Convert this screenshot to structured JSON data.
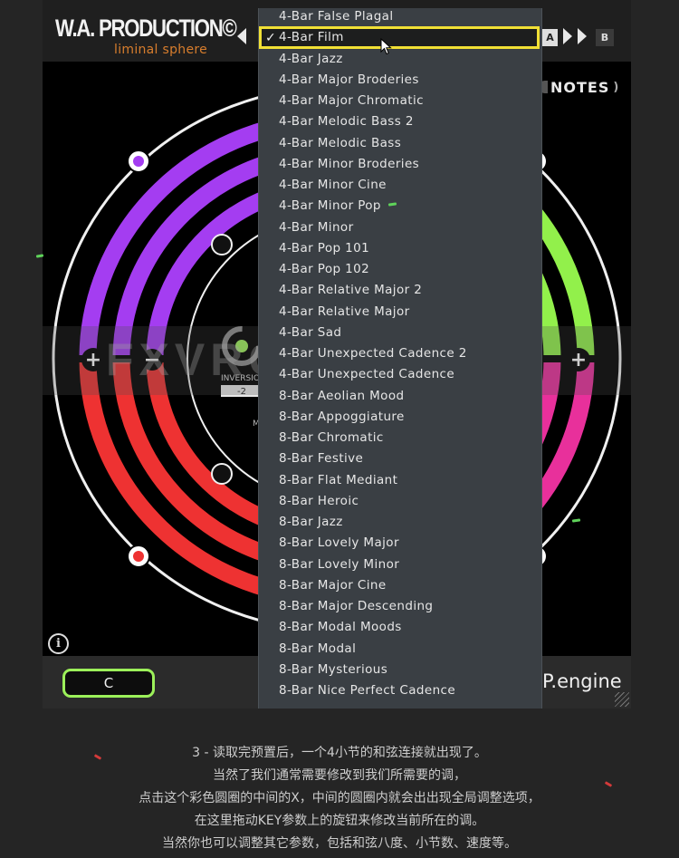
{
  "plugin": {
    "brand": "W.A. PRODUCTION",
    "copyright_mark": "©",
    "product": "liminal sphere",
    "ab_a": "A",
    "ab_b": "B",
    "notes_label": "NOTES",
    "info_icon": "i",
    "key_value": "C",
    "engine_label": "P.engine",
    "wheel": {
      "inversion_label": "INVERSIO",
      "inversion_value": "-2",
      "plus": "+",
      "minus": "−",
      "sub_label": "M",
      "colors": {
        "purple": "#a43df1",
        "red": "#ee3232",
        "green": "#92f04b",
        "pink": "#e8309b"
      }
    },
    "watermark": "FXVRGO.com"
  },
  "dropdown": {
    "selected_index": 1,
    "check_mark": "✓",
    "items": [
      "4-Bar False Plagal",
      "4-Bar Film",
      "4-Bar Jazz",
      "4-Bar Major Broderies",
      "4-Bar Major Chromatic",
      "4-Bar Melodic Bass 2",
      "4-Bar Melodic Bass",
      "4-Bar Minor Broderies",
      "4-Bar Minor Cine",
      "4-Bar Minor Pop",
      "4-Bar Minor",
      "4-Bar Pop 101",
      "4-Bar Pop 102",
      "4-Bar Relative Major 2",
      "4-Bar Relative Major",
      "4-Bar Sad",
      "4-Bar Unexpected Cadence 2",
      "4-Bar Unexpected Cadence",
      "8-Bar Aeolian Mood",
      "8-Bar Appoggiature",
      "8-Bar Chromatic",
      "8-Bar Festive",
      "8-Bar Flat Mediant",
      "8-Bar Heroic",
      "8-Bar Jazz",
      "8-Bar Lovely Major",
      "8-Bar Lovely Minor",
      "8-Bar Major Cine",
      "8-Bar Major Descending",
      "8-Bar Modal Moods",
      "8-Bar Modal",
      "8-Bar Mysterious",
      "8-Bar Nice Perfect Cadence"
    ]
  },
  "caption": {
    "lines": [
      "3 - 读取完预置后，一个4小节的和弦连接就出现了。",
      "当然了我们通常需要修改到我们所需要的调，",
      "点击这个彩色圆圈的中间的X，中间的圆圈内就会出出现全局调整选项，",
      "在这里拖动KEY参数上的旋钮来修改当前所在的调。",
      "当然你也可以调整其它参数，包括和弦八度、小节数、速度等。"
    ]
  }
}
